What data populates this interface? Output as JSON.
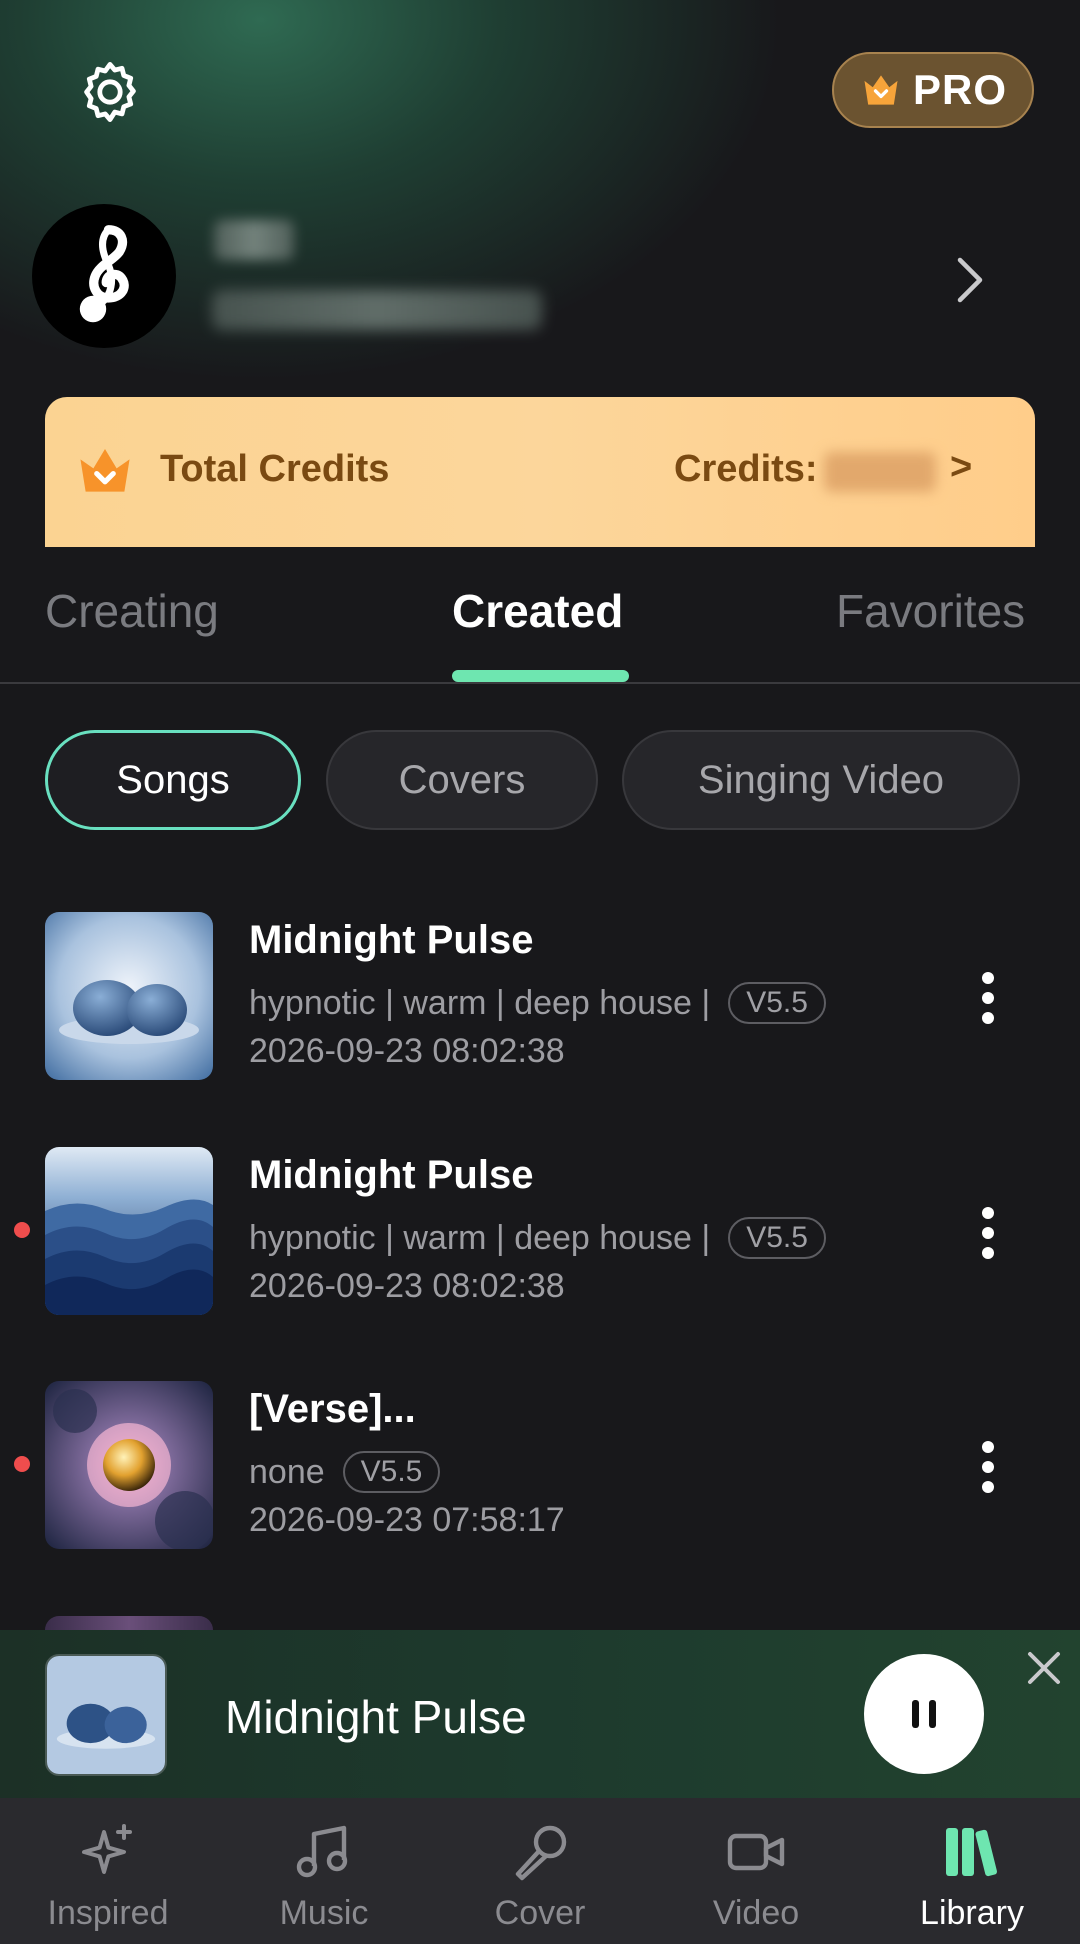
{
  "header": {
    "pro_label": "PRO",
    "icons": {
      "settings": "gear-icon",
      "pro": "crown-icon"
    }
  },
  "profile": {
    "avatar_icon": "music-note-icon",
    "chevron_icon": "chevron-right-icon"
  },
  "credits": {
    "title": "Total Credits",
    "label": "Credits:",
    "arrow": ">"
  },
  "tabs": [
    {
      "label": "Creating",
      "active": false
    },
    {
      "label": "Created",
      "active": true
    },
    {
      "label": "Favorites",
      "active": false
    }
  ],
  "filters": [
    {
      "label": "Songs",
      "active": true
    },
    {
      "label": "Covers",
      "active": false
    },
    {
      "label": "Singing Video",
      "active": false
    }
  ],
  "songs": [
    {
      "title": "Midnight Pulse",
      "tags": "hypnotic | warm | deep house |",
      "version": "V5.5",
      "date": "2026-09-23 08:02:38",
      "unread": false,
      "art": "stones"
    },
    {
      "title": "Midnight Pulse",
      "tags": "hypnotic | warm | deep house |",
      "version": "V5.5",
      "date": "2026-09-23 08:02:38",
      "unread": true,
      "art": "waves"
    },
    {
      "title": "[Verse]...",
      "tags": "none",
      "version": "V5.5",
      "date": "2026-09-23 07:58:17",
      "unread": true,
      "art": "nebula"
    }
  ],
  "player": {
    "title": "Midnight Pulse",
    "pause_icon": "pause-icon",
    "close_icon": "close-icon"
  },
  "nav": [
    {
      "label": "Inspired",
      "icon": "sparkle-icon",
      "active": false
    },
    {
      "label": "Music",
      "icon": "music-note-icon",
      "active": false
    },
    {
      "label": "Cover",
      "icon": "microphone-icon",
      "active": false
    },
    {
      "label": "Video",
      "icon": "video-camera-icon",
      "active": false
    },
    {
      "label": "Library",
      "icon": "library-icon",
      "active": true
    }
  ],
  "colors": {
    "accent": "#6ee6b0",
    "background": "#18181b",
    "credits_text": "#7a4a12",
    "unread_dot": "#ef4d4d"
  }
}
